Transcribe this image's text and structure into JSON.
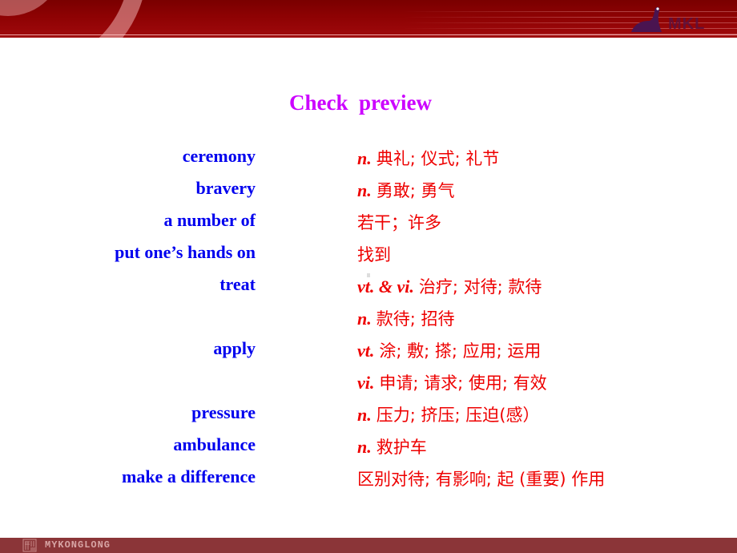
{
  "slide": {
    "title": "Check  preview",
    "colors": {
      "title": "#cc00ff",
      "term": "#0000ee",
      "definition": "#ee0000",
      "header": "#8e0203",
      "footer": "#8b3538"
    },
    "vocab": [
      {
        "term": "ceremony",
        "pos": "n.",
        "definition": "典礼; 仪式; 礼节"
      },
      {
        "term": "bravery",
        "pos": "n.",
        "definition": "勇敢; 勇气"
      },
      {
        "term": "a number of",
        "pos": "",
        "definition": "若干；许多"
      },
      {
        "term": "put one’s hands on",
        "pos": "",
        "definition": "找到"
      },
      {
        "term": "treat",
        "pos": "vt. & vi.",
        "definition": "治疗; 对待; 款待"
      },
      {
        "term": "",
        "pos": "n.",
        "definition": "款待; 招待"
      },
      {
        "term": "apply",
        "pos": "vt.",
        "definition": "涂; 敷; 搽; 应用; 运用"
      },
      {
        "term": "",
        "pos": "vi.",
        "definition": "申请; 请求; 使用; 有效"
      },
      {
        "term": "pressure",
        "pos": "n.",
        "definition": "压力; 挤压; 压迫(感）"
      },
      {
        "term": "ambulance",
        "pos": "n.",
        "definition": "救护车"
      },
      {
        "term": "make a difference",
        "pos": "",
        "definition": "区别对待; 有影响; 起 (重要) 作用"
      }
    ]
  },
  "header": {
    "logo_text": "MKL",
    "logo_icon": "dinosaur-icon"
  },
  "footer": {
    "brand_text": "MYKONGLONG",
    "brand_icon": "brand-seal-icon"
  }
}
